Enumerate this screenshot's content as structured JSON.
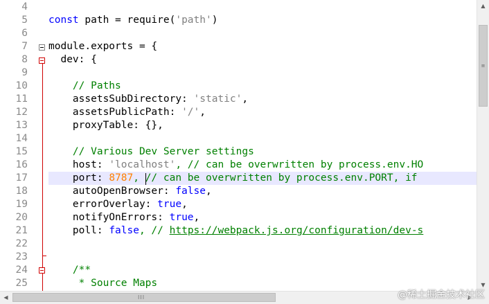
{
  "editor": {
    "lines": [
      {
        "num": "4",
        "tokens": []
      },
      {
        "num": "5",
        "tokens": [
          {
            "t": "const",
            "c": "kw"
          },
          {
            "t": " path = require(",
            "c": ""
          },
          {
            "t": "'path'",
            "c": "str"
          },
          {
            "t": ")",
            "c": ""
          }
        ]
      },
      {
        "num": "6",
        "tokens": []
      },
      {
        "num": "7",
        "tokens": [
          {
            "t": "module.exports = {",
            "c": ""
          }
        ]
      },
      {
        "num": "8",
        "tokens": [
          {
            "t": "  dev: {",
            "c": ""
          }
        ]
      },
      {
        "num": "9",
        "tokens": []
      },
      {
        "num": "10",
        "tokens": [
          {
            "t": "    // Paths",
            "c": "cmt"
          }
        ]
      },
      {
        "num": "11",
        "tokens": [
          {
            "t": "    assetsSubDirectory: ",
            "c": ""
          },
          {
            "t": "'static'",
            "c": "str"
          },
          {
            "t": ",",
            "c": ""
          }
        ]
      },
      {
        "num": "12",
        "tokens": [
          {
            "t": "    assetsPublicPath: ",
            "c": ""
          },
          {
            "t": "'/'",
            "c": "str"
          },
          {
            "t": ",",
            "c": ""
          }
        ]
      },
      {
        "num": "13",
        "tokens": [
          {
            "t": "    proxyTable: {},",
            "c": ""
          }
        ]
      },
      {
        "num": "14",
        "tokens": []
      },
      {
        "num": "15",
        "tokens": [
          {
            "t": "    // Various Dev Server settings",
            "c": "cmt"
          }
        ]
      },
      {
        "num": "16",
        "tokens": [
          {
            "t": "    host: ",
            "c": ""
          },
          {
            "t": "'localhost'",
            "c": "str"
          },
          {
            "t": ", // can be overwritten by process.env.HO",
            "c": "cmt"
          }
        ]
      },
      {
        "num": "17",
        "tokens": [
          {
            "t": "    port: ",
            "c": ""
          },
          {
            "t": "8787",
            "c": "num"
          },
          {
            "t": ", // can be overwritten by process.env.PORT, if",
            "c": "cmt"
          }
        ],
        "current": true
      },
      {
        "num": "18",
        "tokens": [
          {
            "t": "    autoOpenBrowser: ",
            "c": ""
          },
          {
            "t": "false",
            "c": "kw"
          },
          {
            "t": ",",
            "c": ""
          }
        ]
      },
      {
        "num": "19",
        "tokens": [
          {
            "t": "    errorOverlay: ",
            "c": ""
          },
          {
            "t": "true",
            "c": "kw"
          },
          {
            "t": ",",
            "c": ""
          }
        ]
      },
      {
        "num": "20",
        "tokens": [
          {
            "t": "    notifyOnErrors: ",
            "c": ""
          },
          {
            "t": "true",
            "c": "kw"
          },
          {
            "t": ",",
            "c": ""
          }
        ]
      },
      {
        "num": "21",
        "tokens": [
          {
            "t": "    poll: ",
            "c": ""
          },
          {
            "t": "false",
            "c": "kw"
          },
          {
            "t": ", // ",
            "c": "cmt"
          },
          {
            "t": "https://webpack.js.org/configuration/dev-s",
            "c": "lnk"
          }
        ]
      },
      {
        "num": "22",
        "tokens": []
      },
      {
        "num": "23",
        "tokens": []
      },
      {
        "num": "24",
        "tokens": [
          {
            "t": "    /**",
            "c": "cmt"
          }
        ]
      },
      {
        "num": "25",
        "tokens": [
          {
            "t": "     * Source Maps",
            "c": "cmt"
          }
        ]
      }
    ]
  },
  "scrollbars": {
    "up_arrow": "▲",
    "down_arrow": "▼",
    "left_arrow": "◀",
    "right_arrow": "▶",
    "grip": "III"
  },
  "watermark": "@稀土掘金技术社区"
}
